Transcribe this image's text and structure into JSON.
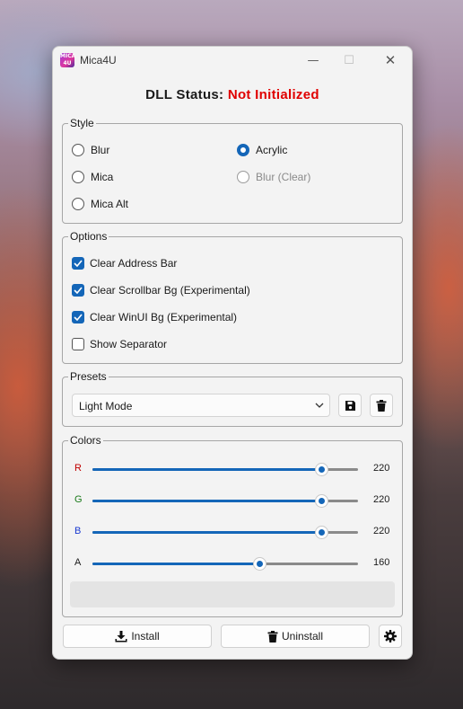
{
  "window": {
    "title": "Mica4U",
    "app_icon_text": "MICA 4U"
  },
  "status": {
    "label": "DLL Status:",
    "value": "Not Initialized",
    "value_color": "#e00000"
  },
  "style": {
    "legend": "Style",
    "options": [
      {
        "label": "Blur",
        "selected": false,
        "enabled": true
      },
      {
        "label": "Acrylic",
        "selected": true,
        "enabled": true
      },
      {
        "label": "Mica",
        "selected": false,
        "enabled": true
      },
      {
        "label": "Blur (Clear)",
        "selected": false,
        "enabled": false
      },
      {
        "label": "Mica Alt",
        "selected": false,
        "enabled": true
      }
    ]
  },
  "options": {
    "legend": "Options",
    "items": [
      {
        "label": "Clear Address Bar",
        "checked": true
      },
      {
        "label": "Clear Scrollbar Bg (Experimental)",
        "checked": true
      },
      {
        "label": "Clear WinUI Bg (Experimental)",
        "checked": true
      },
      {
        "label": "Show Separator",
        "checked": false
      }
    ]
  },
  "presets": {
    "legend": "Presets",
    "selected": "Light Mode",
    "save_icon": "save-icon",
    "delete_icon": "trash-icon"
  },
  "colors": {
    "legend": "Colors",
    "max": 255,
    "channels": [
      {
        "label": "R",
        "value": 220,
        "label_color": "#c00000"
      },
      {
        "label": "G",
        "value": 220,
        "label_color": "#1a7a1a"
      },
      {
        "label": "B",
        "value": 220,
        "label_color": "#1a3ad0"
      },
      {
        "label": "A",
        "value": 160,
        "label_color": "#1a1a1a"
      }
    ],
    "preview_color": "#e4e4e4"
  },
  "actions": {
    "install_label": "Install",
    "uninstall_label": "Uninstall",
    "settings_icon": "gear-icon"
  },
  "accent_color": "#1466b8"
}
